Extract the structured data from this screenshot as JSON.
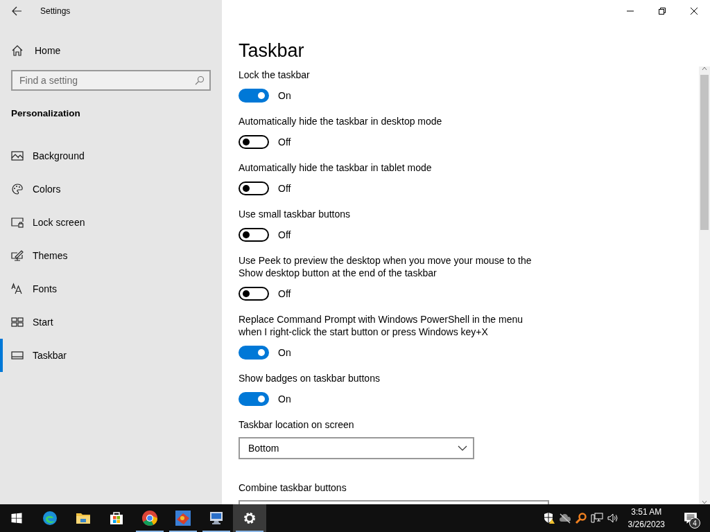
{
  "window": {
    "title": "Settings"
  },
  "sidebar": {
    "home": "Home",
    "search": {
      "placeholder": "Find a setting"
    },
    "section": "Personalization",
    "items": [
      {
        "label": "Background",
        "selected": false
      },
      {
        "label": "Colors",
        "selected": false
      },
      {
        "label": "Lock screen",
        "selected": false
      },
      {
        "label": "Themes",
        "selected": false
      },
      {
        "label": "Fonts",
        "selected": false
      },
      {
        "label": "Start",
        "selected": false
      },
      {
        "label": "Taskbar",
        "selected": true
      }
    ]
  },
  "page": {
    "title": "Taskbar",
    "settings": [
      {
        "kind": "toggle",
        "label": "Lock the taskbar",
        "on": true,
        "state": "On"
      },
      {
        "kind": "toggle",
        "label": "Automatically hide the taskbar in desktop mode",
        "on": false,
        "state": "Off"
      },
      {
        "kind": "toggle",
        "label": "Automatically hide the taskbar in tablet mode",
        "on": false,
        "state": "Off"
      },
      {
        "kind": "toggle",
        "label": "Use small taskbar buttons",
        "on": false,
        "state": "Off"
      },
      {
        "kind": "toggle",
        "label": "Use Peek to preview the desktop when you move your mouse to the Show desktop button at the end of the taskbar",
        "on": false,
        "state": "Off"
      },
      {
        "kind": "toggle",
        "label": "Replace Command Prompt with Windows PowerShell in the menu when I right-click the start button or press Windows key+X",
        "on": true,
        "state": "On"
      },
      {
        "kind": "toggle",
        "label": "Show badges on taskbar buttons",
        "on": true,
        "state": "On"
      },
      {
        "kind": "dropdown",
        "label": "Taskbar location on screen",
        "value": "Bottom"
      },
      {
        "kind": "dropdown",
        "label": "Combine taskbar buttons"
      }
    ]
  },
  "taskbar": {
    "apps": [
      {
        "running": false,
        "selected": false
      },
      {
        "running": false,
        "selected": false
      },
      {
        "running": false,
        "selected": false
      },
      {
        "running": true,
        "selected": false
      },
      {
        "running": true,
        "selected": false
      },
      {
        "running": true,
        "selected": false
      },
      {
        "running": true,
        "selected": true
      }
    ],
    "time": "3:51 AM",
    "date": "3/26/2023",
    "notifications": "4"
  }
}
